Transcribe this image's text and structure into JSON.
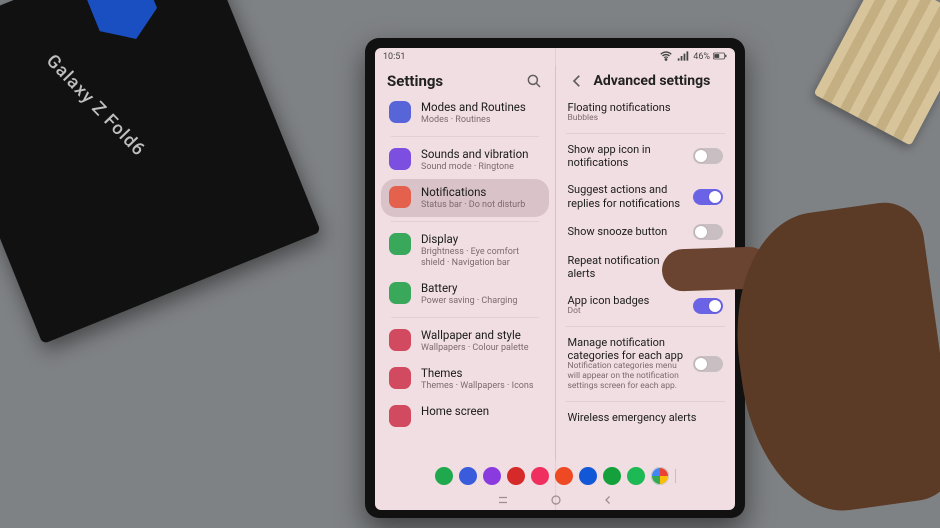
{
  "box_label": "Galaxy Z Fold6",
  "status": {
    "time": "10:51",
    "battery": "46%"
  },
  "left": {
    "title": "Settings",
    "items": [
      {
        "title": "Modes and Routines",
        "sub": "Modes · Routines",
        "color": "#5865d8"
      },
      {
        "title": "Sounds and vibration",
        "sub": "Sound mode · Ringtone",
        "color": "#7d4fe0"
      },
      {
        "title": "Notifications",
        "sub": "Status bar · Do not disturb",
        "color": "#e3614d",
        "selected": true
      },
      {
        "title": "Display",
        "sub": "Brightness · Eye comfort shield · Navigation bar",
        "color": "#39a85a"
      },
      {
        "title": "Battery",
        "sub": "Power saving · Charging",
        "color": "#39a85a"
      },
      {
        "title": "Wallpaper and style",
        "sub": "Wallpapers · Colour palette",
        "color": "#d24a5f"
      },
      {
        "title": "Themes",
        "sub": "Themes · Wallpapers · Icons",
        "color": "#d24a5f"
      },
      {
        "title": "Home screen",
        "sub": "",
        "color": "#d24a5f"
      }
    ]
  },
  "right": {
    "title": "Advanced settings",
    "rows": [
      {
        "title": "Floating notifications",
        "sub": "Bubbles",
        "type": "link"
      },
      {
        "title": "Show app icon in notifications",
        "type": "toggle",
        "on": false
      },
      {
        "title": "Suggest actions and replies for notifications",
        "type": "toggle",
        "on": true
      },
      {
        "title": "Show snooze button",
        "type": "toggle",
        "on": false
      },
      {
        "title": "Repeat notification alerts",
        "type": "toggle",
        "on": false
      },
      {
        "title": "App icon badges",
        "sub": "Dot",
        "type": "toggle",
        "on": true
      },
      {
        "title": "Manage notification categories for each app",
        "sub": "Notification categories menu will appear on the notification settings screen for each app.",
        "type": "toggle",
        "on": false
      },
      {
        "title": "Wireless emergency alerts",
        "type": "link"
      }
    ]
  },
  "dock_colors": [
    "#1fa84e",
    "#3a5bdc",
    "#8a3be0",
    "#d62a2a",
    "#ef2f5e",
    "#ef4923",
    "#1157d6",
    "#14a03a",
    "#1db954",
    "#ffffff"
  ]
}
